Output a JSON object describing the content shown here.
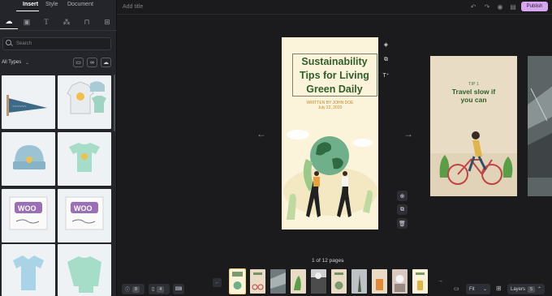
{
  "sidebar": {
    "tabs": [
      {
        "label": "Insert"
      },
      {
        "label": "Style"
      },
      {
        "label": "Document"
      }
    ],
    "icon_tabs": [
      "upload-cloud-icon",
      "image-icon",
      "text-icon",
      "shapes-icon",
      "bag-icon",
      "grid-icon"
    ],
    "search": {
      "placeholder": "Search"
    },
    "filter": {
      "label": "All Types"
    },
    "filter_buttons": [
      "video-icon",
      "link-icon",
      "cloud-upload-icon"
    ]
  },
  "topbar": {
    "title_placeholder": "Add title",
    "publish_label": "Publish"
  },
  "story_page": {
    "title_lines": [
      "Sustainability",
      "Tips for Living",
      "Green Daily"
    ],
    "written_by": "WRITTEN BY JOHN DOE",
    "date": "July 22, 2020"
  },
  "card_tip": {
    "tip_label": "TIP 1",
    "lines": [
      "Travel slow if",
      "you can"
    ]
  },
  "footer": {
    "page_count": "1 of 12 pages",
    "checklist_count": "8",
    "accessibility_count": "4",
    "zoom": "Fit",
    "layers_label": "Layers",
    "layers_count": "5"
  },
  "colors": {
    "accent": "#d6a6f0",
    "title_green": "#2f5f2a",
    "page_bg": "#fbf3da"
  }
}
